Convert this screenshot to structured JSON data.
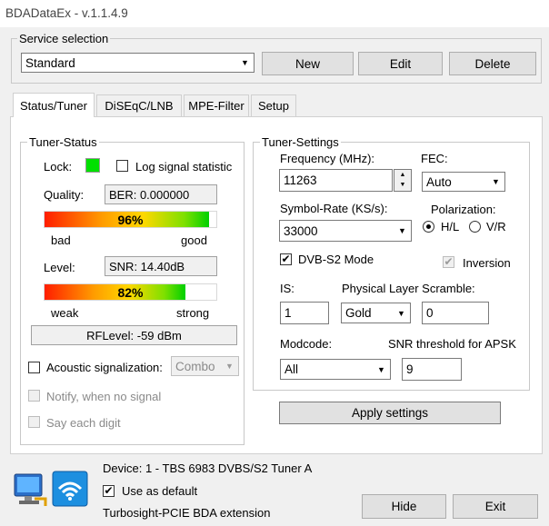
{
  "window": {
    "title": "BDADataEx - v.1.1.4.9"
  },
  "service": {
    "legend": "Service selection",
    "selected": "Standard",
    "new_label": "New",
    "edit_label": "Edit",
    "delete_label": "Delete"
  },
  "tabs": [
    {
      "label": "Status/Tuner",
      "active": true
    },
    {
      "label": "DiSEqC/LNB"
    },
    {
      "label": "MPE-Filter"
    },
    {
      "label": "Setup"
    }
  ],
  "tuner_status": {
    "legend": "Tuner-Status",
    "lock_label": "Lock:",
    "lock_color": "#00e000",
    "log_signal_label": "Log signal statistic",
    "log_signal_checked": false,
    "quality_label": "Quality:",
    "ber_text": "BER: 0.000000",
    "quality_percent_text": "96%",
    "quality_fraction": 0.96,
    "quality_low": "bad",
    "quality_high": "good",
    "level_label": "Level:",
    "snr_text": "SNR: 14.40dB",
    "level_percent_text": "82%",
    "level_fraction": 0.82,
    "level_low": "weak",
    "level_high": "strong",
    "rflevel_text": "RFLevel: -59 dBm",
    "acoustic_label": "Acoustic signalization:",
    "acoustic_checked": false,
    "acoustic_mode": "Combo",
    "notify_label": "Notify, when no signal",
    "say_digit_label": "Say each digit"
  },
  "tuner_settings": {
    "legend": "Tuner-Settings",
    "frequency_label": "Frequency (MHz):",
    "frequency_value": "11263",
    "fec_label": "FEC:",
    "fec_value": "Auto",
    "symbol_rate_label": "Symbol-Rate (KS/s):",
    "symbol_rate_value": "33000",
    "polarization_label": "Polarization:",
    "pol_hl": "H/L",
    "pol_vr": "V/R",
    "pol_selected": "H/L",
    "dvbs2_label": "DVB-S2 Mode",
    "dvbs2_checked": true,
    "inversion_label": "Inversion",
    "inversion_checked": true,
    "is_label": "IS:",
    "is_value": "1",
    "pls_label": "Physical Layer Scramble:",
    "pls_mode": "Gold",
    "pls_value": "0",
    "modcode_label": "Modcode:",
    "modcode_value": "All",
    "snr_threshold_label": "SNR threshold for APSK",
    "snr_threshold_value": "9",
    "apply_label": "Apply settings"
  },
  "footer": {
    "device_text": "Device: 1 - TBS 6983 DVBS/S2 Tuner A",
    "use_default_label": "Use as default",
    "use_default_checked": true,
    "extension_text": "Turbosight-PCIE BDA extension",
    "hide_label": "Hide",
    "exit_label": "Exit"
  },
  "icons": [
    "monitor-network-icon",
    "wifi-icon",
    "dropdown-arrow-icon",
    "spinner-icon",
    "check-icon"
  ]
}
